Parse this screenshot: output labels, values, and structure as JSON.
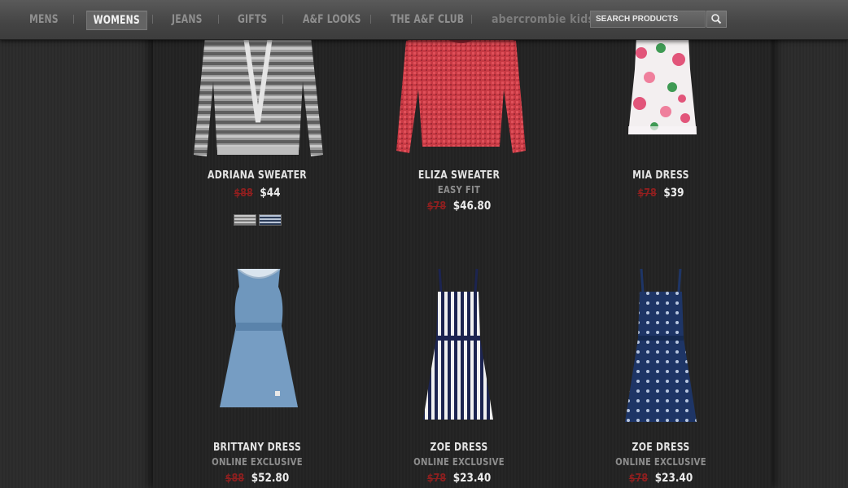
{
  "nav": {
    "items": [
      "MENS",
      "WOMENS",
      "JEANS",
      "GIFTS",
      "A&F LOOKS",
      "THE A&F CLUB",
      "abercrombie kids"
    ],
    "active": "WOMENS",
    "search_placeholder": "SEARCH PRODUCTS",
    "search_icon": "magnifier-icon"
  },
  "products": [
    {
      "name": "ADRIANA SWEATER",
      "tag": "",
      "old_price": "$88",
      "price": "$44",
      "swatches": [
        "gray-stripe",
        "blue-stripe"
      ]
    },
    {
      "name": "ELIZA SWEATER",
      "tag": "EASY FIT",
      "old_price": "$78",
      "price": "$46.80"
    },
    {
      "name": "MIA DRESS",
      "tag": "",
      "old_price": "$78",
      "price": "$39"
    },
    {
      "name": "BRITTANY DRESS",
      "tag": "ONLINE EXCLUSIVE",
      "old_price": "$88",
      "price": "$52.80"
    },
    {
      "name": "ZOE DRESS",
      "tag": "ONLINE EXCLUSIVE",
      "old_price": "$78",
      "price": "$23.40"
    },
    {
      "name": "ZOE DRESS",
      "tag": "ONLINE EXCLUSIVE",
      "old_price": "$78",
      "price": "$23.40"
    }
  ],
  "colors": {
    "nav_bg": "#4a4a4a",
    "old_price": "#8e1f1f",
    "active_tab": "#646464"
  }
}
